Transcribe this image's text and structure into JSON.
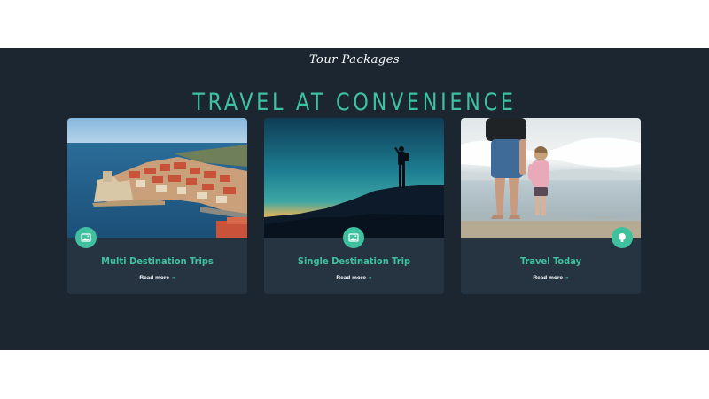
{
  "section": {
    "script_title": "Tour Packages",
    "main_title": "TRAVEL AT CONVENIENCE",
    "accent_color": "#3fc1a0",
    "background_color": "#1b2631"
  },
  "cards": [
    {
      "title": "Multi Destination Trips",
      "link": "Read more",
      "chevron": "»",
      "icon": "image-icon"
    },
    {
      "title": "Single Destination Trip",
      "link": "Read more",
      "chevron": "»",
      "icon": "image-icon"
    },
    {
      "title": "Travel Today",
      "link": "Read more",
      "chevron": "»",
      "icon": "balloon-icon"
    }
  ]
}
